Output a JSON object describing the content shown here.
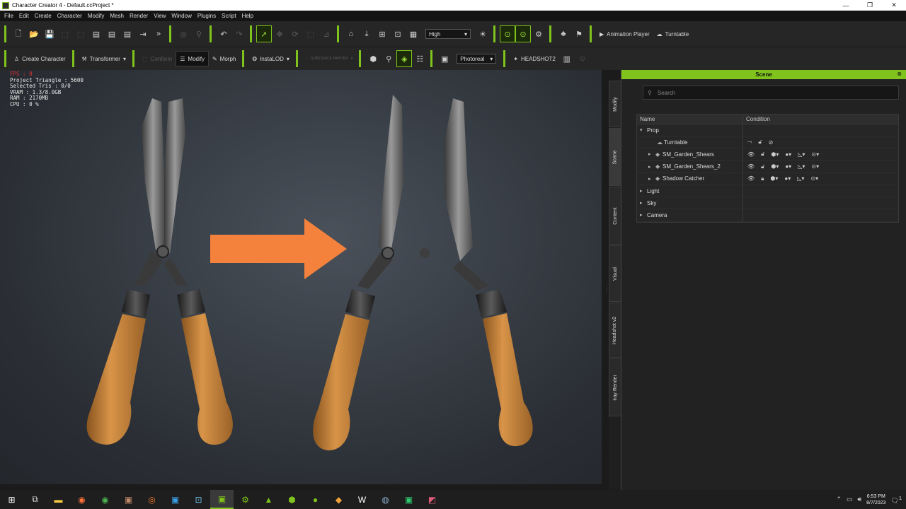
{
  "window": {
    "title": "Character Creator 4 - Default.ccProject *",
    "controls": [
      "minimize-icon",
      "restore-icon",
      "close-icon"
    ]
  },
  "menu": [
    "File",
    "Edit",
    "Create",
    "Character",
    "Modify",
    "Mesh",
    "Render",
    "View",
    "Window",
    "Plugins",
    "Script",
    "Help"
  ],
  "toolbar1": {
    "quality": "High",
    "animation_player": "Animation Player",
    "turntable": "Turntable"
  },
  "toolbar2": {
    "create_character": "Create Character",
    "transformer": "Transformer",
    "conform": "Conform",
    "modify": "Modify",
    "morph": "Morph",
    "instalod": "InstaLOD",
    "substance": "SUBSTANCE PAINTER",
    "render_mode": "Photoreal",
    "headshot": "HEADSHOT2"
  },
  "stats": {
    "fps": "FPS : 0",
    "project_triangle": "Project Triangle : 5600",
    "selected_tris": "Selected Tris : 0/0",
    "vram": "VRAM : 1.3/8.0GB",
    "ram": "RAM : 2170MB",
    "cpu": "CPU : 0 %"
  },
  "side_tabs": [
    "Modify",
    "Scene",
    "Content",
    "Visual",
    "Headshot v2",
    "Iray Render"
  ],
  "scene_panel": {
    "title": "Scene",
    "search_placeholder": "Search",
    "columns": {
      "name": "Name",
      "condition": "Condition"
    },
    "rows": [
      {
        "label": "Prop",
        "level": 0,
        "expanded": true
      },
      {
        "label": "Turntable",
        "level": 1
      },
      {
        "label": "SM_Garden_Shears",
        "level": 1
      },
      {
        "label": "SM_Garden_Shears_2",
        "level": 1
      },
      {
        "label": "Shadow Catcher",
        "level": 1
      },
      {
        "label": "Light",
        "level": 0
      },
      {
        "label": "Sky",
        "level": 0
      },
      {
        "label": "Camera",
        "level": 0
      }
    ]
  },
  "taskbar": {
    "time": "6:53 PM",
    "date": "8/7/2023",
    "notifications": "1"
  },
  "colors": {
    "accent": "#7fc31c",
    "arrow": "#f5823c",
    "panel": "#222222"
  }
}
